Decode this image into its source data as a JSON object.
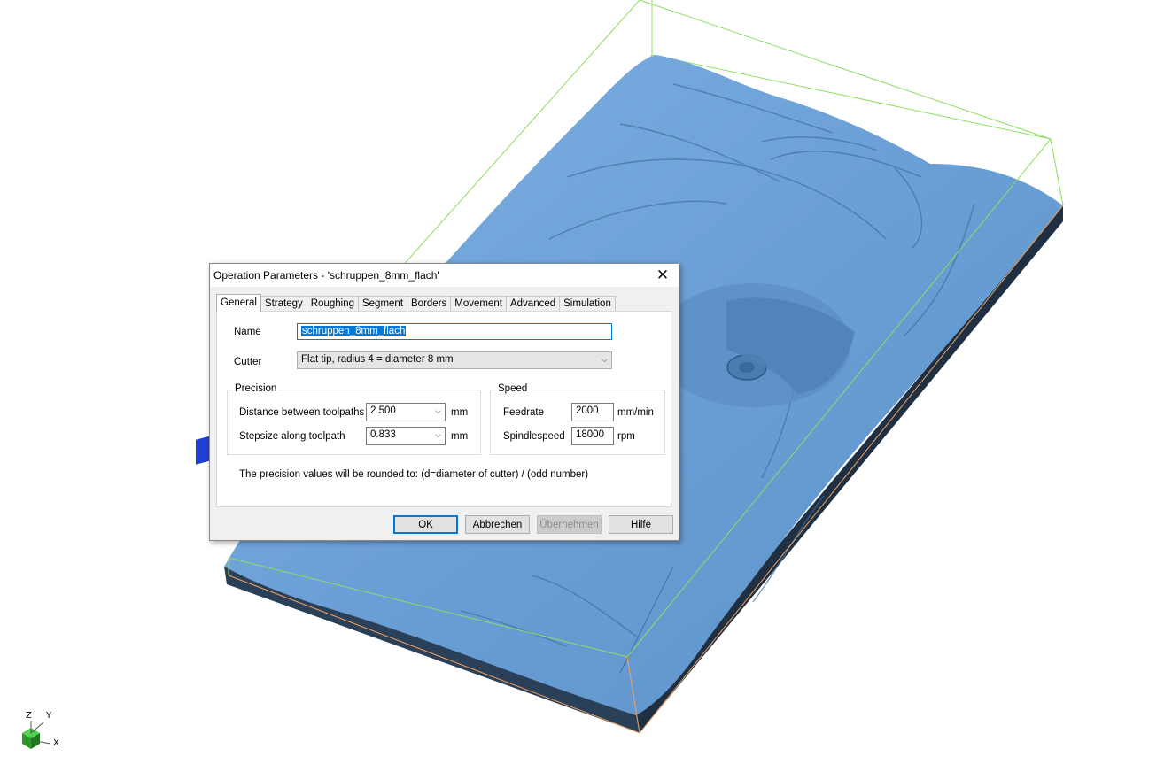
{
  "dialog": {
    "title": "Operation Parameters - 'schruppen_8mm_flach'",
    "close_icon": "close-icon"
  },
  "tabs": [
    {
      "label": "General",
      "active": true
    },
    {
      "label": "Strategy"
    },
    {
      "label": "Roughing"
    },
    {
      "label": "Segment"
    },
    {
      "label": "Borders"
    },
    {
      "label": "Movement"
    },
    {
      "label": "Advanced"
    },
    {
      "label": "Simulation"
    }
  ],
  "general": {
    "name_label": "Name",
    "name_value": "schruppen_8mm_flach",
    "cutter_label": "Cutter",
    "cutter_value": "Flat tip, radius 4 = diameter 8 mm"
  },
  "precision": {
    "title": "Precision",
    "distance_label": "Distance between toolpaths",
    "distance_value": "2.500",
    "distance_unit": "mm",
    "stepsize_label": "Stepsize along toolpath",
    "stepsize_value": "0.833",
    "stepsize_unit": "mm"
  },
  "speed": {
    "title": "Speed",
    "feedrate_label": "Feedrate",
    "feedrate_value": "2000",
    "feedrate_unit": "mm/min",
    "spindle_label": "Spindlespeed",
    "spindle_value": "18000",
    "spindle_unit": "rpm"
  },
  "note": "The precision values will be rounded to:  (d=diameter of cutter) / (odd number)",
  "buttons": {
    "ok": "OK",
    "cancel": "Abbrechen",
    "apply": "Übernehmen",
    "help": "Hilfe"
  },
  "axes": {
    "z": "Z",
    "y": "Y",
    "x": "X"
  },
  "colors": {
    "model": "#6fa3d9",
    "model_dark": "#1e3042",
    "bbox_green": "#7fd84f",
    "bbox_orange": "#f0a060",
    "accent": "#0078d7"
  }
}
